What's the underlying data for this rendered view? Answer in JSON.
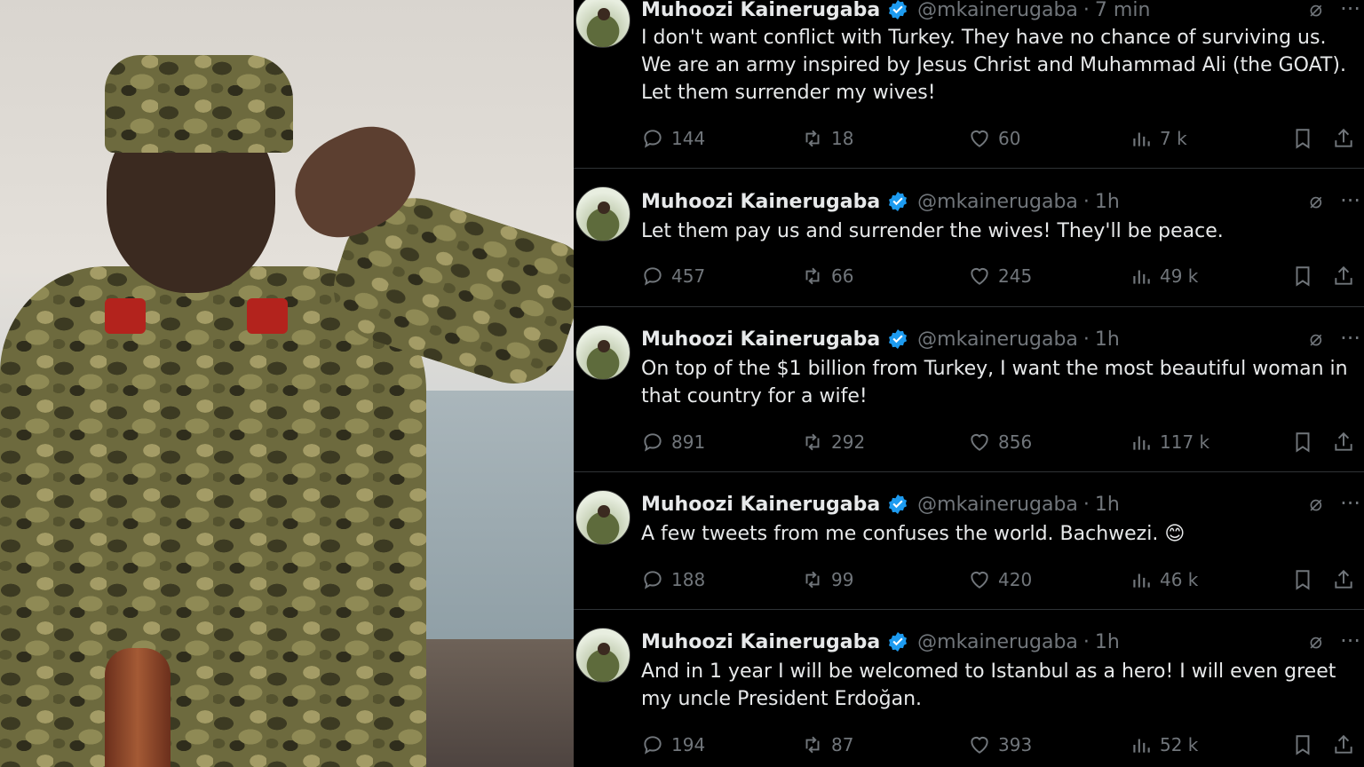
{
  "colors": {
    "background": "#000000",
    "text": "#e7e9ea",
    "muted": "#71767b",
    "verified": "#1d9bf0",
    "divider": "#2f3336"
  },
  "tweets": [
    {
      "name": "Muhoozi Kainerugaba",
      "handle": "@mkainerugaba",
      "time": "7 min",
      "text": "I don't want conflict with Turkey. They have no chance of surviving us. We are an army inspired by Jesus Christ and Muhammad Ali (the GOAT). Let them surrender my wives!",
      "replies": "144",
      "retweets": "18",
      "likes": "60",
      "views": "7 k"
    },
    {
      "name": "Muhoozi Kainerugaba",
      "handle": "@mkainerugaba",
      "time": "1h",
      "text": "Let them pay us and surrender the wives! They'll be peace.",
      "replies": "457",
      "retweets": "66",
      "likes": "245",
      "views": "49 k"
    },
    {
      "name": "Muhoozi Kainerugaba",
      "handle": "@mkainerugaba",
      "time": "1h",
      "text": "On top of the $1 billion from Turkey, I want the most beautiful woman in that country for a wife!",
      "replies": "891",
      "retweets": "292",
      "likes": "856",
      "views": "117 k"
    },
    {
      "name": "Muhoozi Kainerugaba",
      "handle": "@mkainerugaba",
      "time": "1h",
      "text": "A few tweets from me confuses the world. Bachwezi. 😊",
      "replies": "188",
      "retweets": "99",
      "likes": "420",
      "views": "46 k"
    },
    {
      "name": "Muhoozi Kainerugaba",
      "handle": "@mkainerugaba",
      "time": "1h",
      "text": "And in 1 year I will be welcomed to Istanbul as a hero! I will even greet my uncle President Erdoğan.",
      "replies": "194",
      "retweets": "87",
      "likes": "393",
      "views": "52 k"
    }
  ]
}
